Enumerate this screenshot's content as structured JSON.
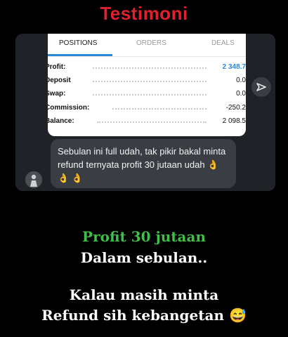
{
  "heading": "Testimoni",
  "card": {
    "tabs": [
      "POSITIONS",
      "ORDERS",
      "DEALS"
    ],
    "rows": [
      {
        "label": "Profit:",
        "value": "2 348.7"
      },
      {
        "label": "Deposit",
        "value": "0.0"
      },
      {
        "label": "Swap:",
        "value": "0.0"
      },
      {
        "label": "Commission:",
        "value": "-250.2"
      },
      {
        "label": "Balance:",
        "value": "2 098.5"
      }
    ]
  },
  "message": {
    "text": "Sebulan ini full udah, tak pikir bakal minta refund ternyata profit 30 jutaan udah",
    "emoji": "👌 👌 👌"
  },
  "caption": {
    "line1": "Profit 30 jutaan",
    "line2": "Dalam sebulan..",
    "line3": "Kalau masih minta",
    "line4": "Refund sih kebangetan",
    "line4_emoji": "😅"
  },
  "colors": {
    "heading": "#e0202e",
    "accent": "#2d88d6",
    "caption_green": "#3fbf4a",
    "bubble": "#3a3e44"
  },
  "icons": {
    "share": "send-arrow-icon",
    "avatar": "avatar"
  }
}
